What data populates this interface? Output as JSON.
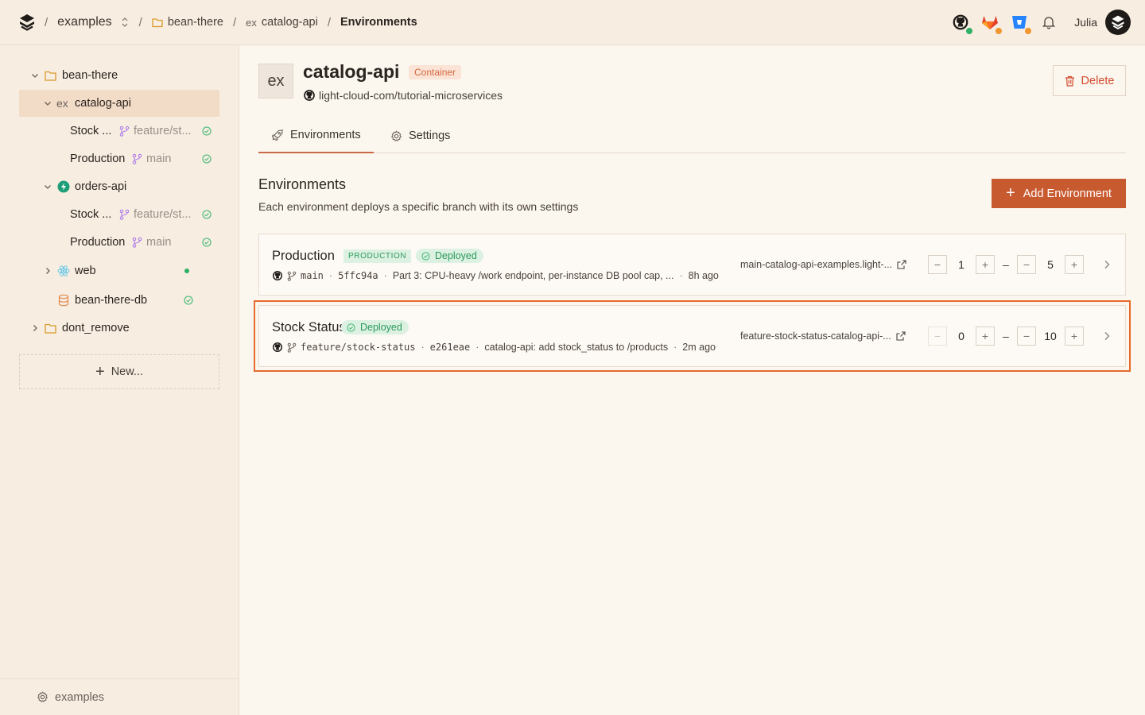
{
  "breadcrumbs": {
    "workspace": "examples",
    "project": "bean-there",
    "service_prefix": "ex",
    "service": "catalog-api",
    "current": "Environments",
    "separator": "/"
  },
  "user": {
    "name": "Julia"
  },
  "sidebar": {
    "tree": [
      {
        "label": "bean-there",
        "type": "project"
      },
      {
        "label": "catalog-api",
        "prefix": "ex",
        "type": "service",
        "selected": true
      },
      {
        "label": "Stock ...",
        "branch": "feature/st...",
        "status": "ok"
      },
      {
        "label": "Production",
        "branch": "main",
        "status": "ok"
      },
      {
        "label": "orders-api",
        "type": "service"
      },
      {
        "label": "Stock ...",
        "branch": "feature/st...",
        "status": "ok"
      },
      {
        "label": "Production",
        "branch": "main",
        "status": "ok"
      },
      {
        "label": "web",
        "type": "service",
        "status": "running"
      },
      {
        "label": "bean-there-db",
        "type": "database",
        "status": "ok"
      },
      {
        "label": "dont_remove",
        "type": "project"
      }
    ],
    "new_label": "New...",
    "footer_label": "examples"
  },
  "service": {
    "tile": "ex",
    "name": "catalog-api",
    "badge": "Container",
    "repo": "light-cloud-com/tutorial-microservices",
    "delete_label": "Delete"
  },
  "tabs": [
    {
      "label": "Environments",
      "active": true
    },
    {
      "label": "Settings",
      "active": false
    }
  ],
  "environments_section": {
    "title": "Environments",
    "subtitle": "Each environment deploys a specific branch with its own settings",
    "add_label": "Add Environment"
  },
  "environments": [
    {
      "name": "Production",
      "prod_badge": "PRODUCTION",
      "status": "Deployed",
      "branch": "main",
      "commit": "5ffc94a",
      "message": "Part 3: CPU-heavy /work endpoint, per-instance DB pool cap, ...",
      "time": "8h ago",
      "url": "main-catalog-api-examples.light-...",
      "min": "1",
      "max": "5",
      "highlighted": false
    },
    {
      "name": "Stock Status",
      "status": "Deployed",
      "branch": "feature/stock-status",
      "commit": "e261eae",
      "message": "catalog-api: add stock_status to /products",
      "time": "2m ago",
      "url": "feature-stock-status-catalog-api-...",
      "min": "0",
      "max": "10",
      "highlighted": true
    }
  ],
  "range_separator": "–",
  "colors": {
    "accent": "#c85a30",
    "highlight": "#e46b2a",
    "deployed": "#2a9a5a",
    "danger": "#d44b2e"
  }
}
